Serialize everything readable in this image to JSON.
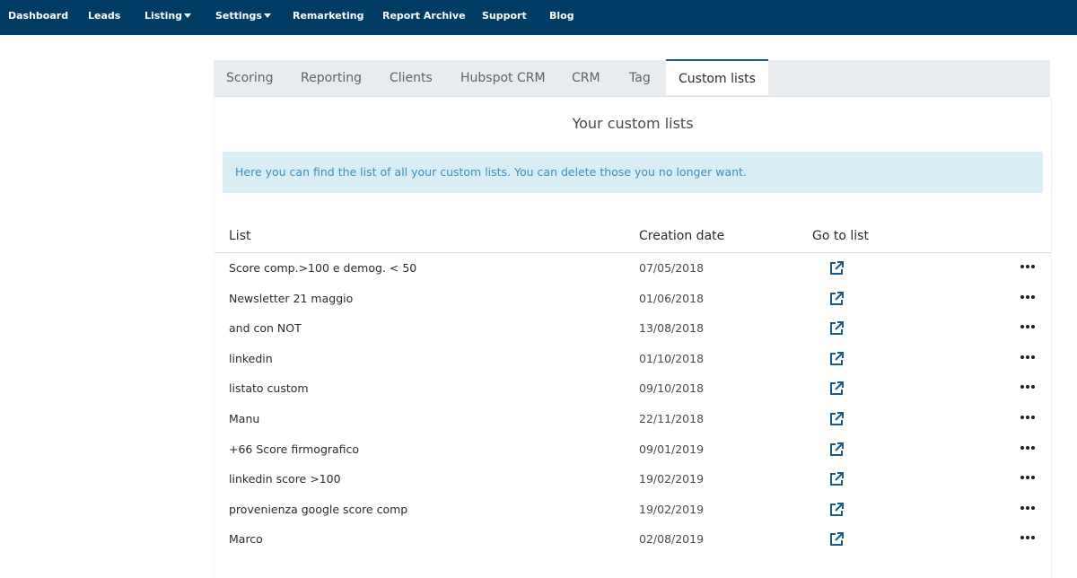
{
  "nav": {
    "items": [
      {
        "label": "Dashboard",
        "dropdown": false
      },
      {
        "label": "Leads",
        "dropdown": false
      },
      {
        "label": "Listing",
        "dropdown": true
      },
      {
        "label": "Settings",
        "dropdown": true
      },
      {
        "label": "Remarketing",
        "dropdown": false
      },
      {
        "label": "Report Archive",
        "dropdown": false
      },
      {
        "label": "Support",
        "dropdown": false
      },
      {
        "label": "Blog",
        "dropdown": false
      }
    ]
  },
  "tabs": [
    {
      "label": "Scoring",
      "active": false
    },
    {
      "label": "Reporting",
      "active": false
    },
    {
      "label": "Clients",
      "active": false
    },
    {
      "label": "Hubspot CRM",
      "active": false
    },
    {
      "label": "CRM",
      "active": false
    },
    {
      "label": "Tag",
      "active": false
    },
    {
      "label": "Custom lists",
      "active": true
    }
  ],
  "panel": {
    "title": "Your custom lists",
    "info": "Here you can find the list of all your custom lists. You can delete those you no longer want."
  },
  "table": {
    "headers": {
      "list": "List",
      "created": "Creation date",
      "goto": "Go to list"
    },
    "rows": [
      {
        "name": "Score comp.>100 e demog. < 50",
        "date": "07/05/2018"
      },
      {
        "name": "Newsletter 21 maggio",
        "date": "01/06/2018"
      },
      {
        "name": "and con NOT",
        "date": "13/08/2018"
      },
      {
        "name": "linkedin",
        "date": "01/10/2018"
      },
      {
        "name": "listato custom",
        "date": "09/10/2018"
      },
      {
        "name": "Manu",
        "date": "22/11/2018"
      },
      {
        "name": "+66 Score firmografico",
        "date": "09/01/2019"
      },
      {
        "name": "linkedin score >100",
        "date": "19/02/2019"
      },
      {
        "name": "provenienza google score comp",
        "date": "19/02/2019"
      },
      {
        "name": "Marco",
        "date": "02/08/2019"
      }
    ]
  },
  "icons": {
    "goto": "external-link-icon",
    "menu": "more-horizontal-icon"
  },
  "colors": {
    "nav_bg": "#003c64",
    "accent": "#1b5a86",
    "info_bg": "#d9edf5",
    "info_text": "#3b8fc1"
  }
}
